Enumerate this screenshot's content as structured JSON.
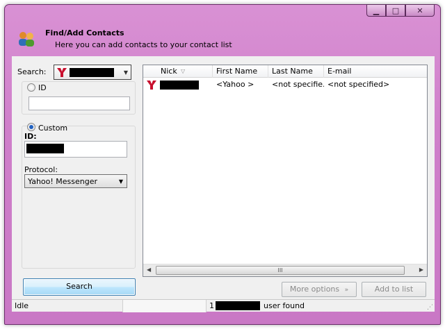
{
  "window": {
    "title": "Find/Add Contacts",
    "subtitle": "Here you can add contacts to your contact list",
    "controls": {
      "minimize": "▁",
      "maximize": "□",
      "close": "✕"
    }
  },
  "search": {
    "label": "Search:",
    "protocol_icon": "yahoo-icon",
    "selected": "[redacted]"
  },
  "id_group": {
    "radio_label": "ID",
    "value": "",
    "selected": false
  },
  "custom_group": {
    "radio_label": "Custom",
    "selected": true,
    "id_label": "ID:",
    "id_value": "[redacted]",
    "protocol_label": "Protocol:",
    "protocol_value": "Yahoo! Messenger"
  },
  "buttons": {
    "search": "Search",
    "more_options": "More options",
    "more_options_icon": "double-chevron-down-icon",
    "add_to_list": "Add to list"
  },
  "results": {
    "columns": [
      "Nick",
      "First Name",
      "Last Name",
      "E-mail"
    ],
    "rows": [
      {
        "icon": "yahoo-icon",
        "nick": "[redacted]",
        "first_name": "<Yahoo >",
        "last_name": "<not specifie...",
        "email": "<not specified>"
      }
    ],
    "scroll_thumb": "III"
  },
  "status": {
    "state": "Idle",
    "count": "1",
    "found_text": "user found"
  },
  "colors": {
    "window_frame": "#cf7fca",
    "search_button": "#bee6fd",
    "yahoo_red": "#c8102e"
  }
}
